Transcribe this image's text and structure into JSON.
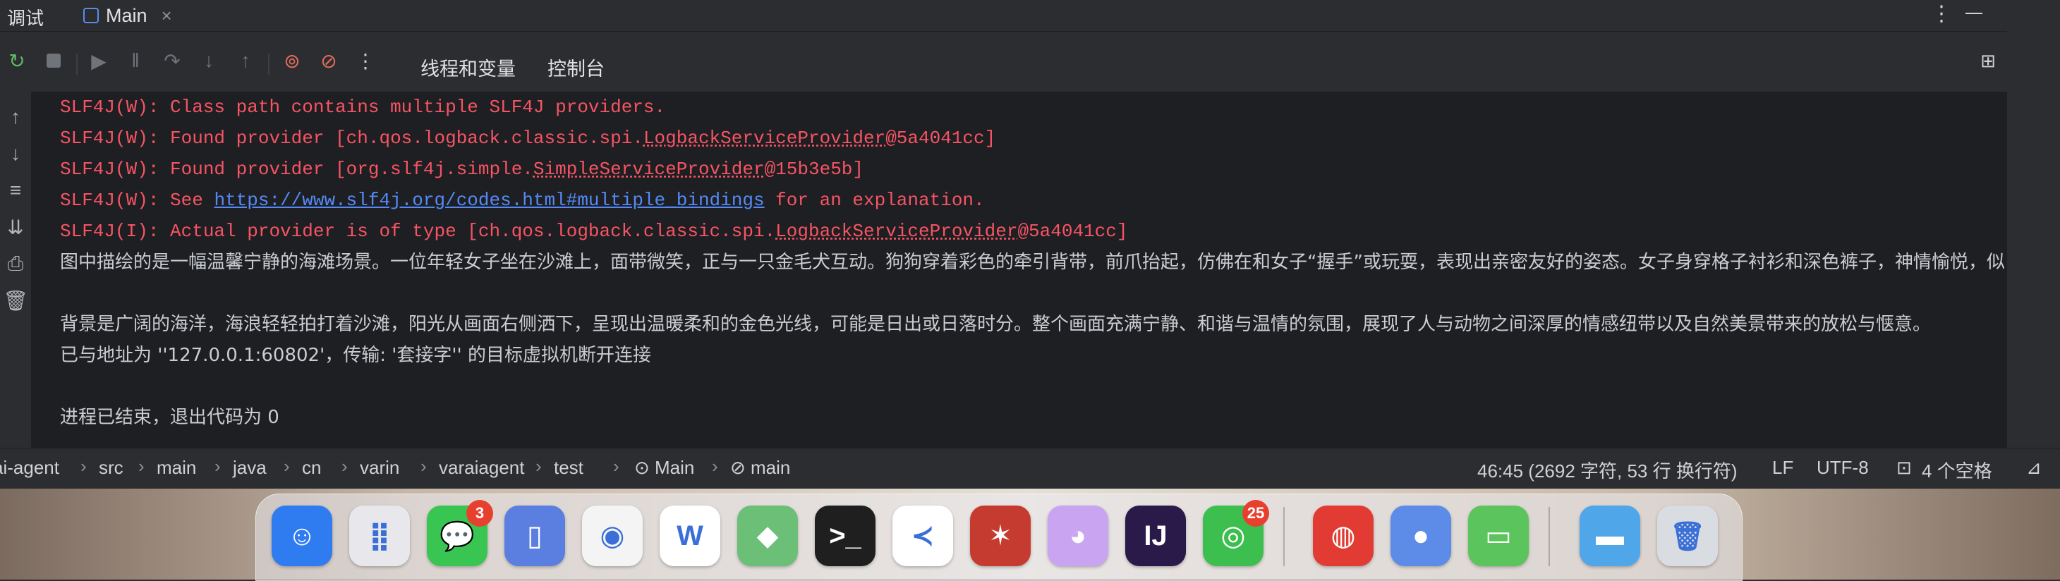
{
  "header": {
    "tool_title": "调试",
    "tab_label": "Main",
    "tab_close": "×",
    "more": "⋮"
  },
  "toolbar": {
    "tabs": [
      "线程和变量",
      "控制台"
    ],
    "active_tab": "控制台"
  },
  "console": {
    "lines": [
      {
        "type": "err",
        "parts": [
          {
            "t": "SLF4J(W): Class path contains multiple SLF4J providers."
          }
        ]
      },
      {
        "type": "err",
        "parts": [
          {
            "t": "SLF4J(W): Found provider [ch.qos.logback.classic.spi."
          },
          {
            "t": "LogbackServiceProvider",
            "dot": true
          },
          {
            "t": "@5a4041cc]"
          }
        ]
      },
      {
        "type": "err",
        "parts": [
          {
            "t": "SLF4J(W): Found provider [org.slf4j.simple."
          },
          {
            "t": "SimpleServiceProvider",
            "dot": true
          },
          {
            "t": "@15b3e5b]"
          }
        ]
      },
      {
        "type": "err",
        "parts": [
          {
            "t": "SLF4J(W): See "
          },
          {
            "t": "https://www.slf4j.org/codes.html#multiple_bindings",
            "link": true
          },
          {
            "t": " for an explanation."
          }
        ]
      },
      {
        "type": "err",
        "parts": [
          {
            "t": "SLF4J(I): Actual provider is of type [ch.qos.logback.classic.spi."
          },
          {
            "t": "LogbackServiceProvider",
            "dot": true
          },
          {
            "t": "@5a4041cc]"
          }
        ]
      },
      {
        "type": "info",
        "parts": [
          {
            "t": "图中描绘的是一幅温馨宁静的海滩场景。一位年轻女子坐在沙滩上，面带微笑，正与一只金毛犬互动。狗狗穿着彩色的牵引背带，前爪抬起，仿佛在和女子“握手”或玩耍，表现出亲密友好的姿态。女子身穿格子衬衫和深色裤子，神情愉悦，似"
          }
        ]
      },
      {
        "type": "blank",
        "parts": []
      },
      {
        "type": "info",
        "parts": [
          {
            "t": "背景是广阔的海洋，海浪轻轻拍打着沙滩，阳光从画面右侧洒下，呈现出温暖柔和的金色光线，可能是日出或日落时分。整个画面充满宁静、和谐与温情的氛围，展现了人与动物之间深厚的情感纽带以及自然美景带来的放松与惬意。"
          }
        ]
      },
      {
        "type": "info",
        "parts": [
          {
            "t": "已与地址为 ''127.0.0.1:60802'，传输: '套接字'' 的目标虚拟机断开连接"
          }
        ]
      },
      {
        "type": "blank",
        "parts": []
      },
      {
        "type": "info",
        "parts": [
          {
            "t": "进程已结束，退出代码为 0"
          }
        ]
      }
    ]
  },
  "breadcrumb": [
    "ai-agent",
    "src",
    "main",
    "java",
    "cn",
    "varin",
    "varaiagent",
    "test",
    "Main",
    "main"
  ],
  "status": {
    "position": "46:45 (2692 字符, 53 行 换行符)",
    "line_sep": "LF",
    "encoding": "UTF-8",
    "indent": "4 个空格"
  },
  "dock": {
    "apps": [
      {
        "name": "finder",
        "glyph": "☺",
        "color": "#2f7bf0"
      },
      {
        "name": "launchpad",
        "glyph": "⣿",
        "color": "#e8e8ec"
      },
      {
        "name": "messages",
        "glyph": "💬",
        "color": "#39c552",
        "badge": "3"
      },
      {
        "name": "iphone-mirroring",
        "glyph": "▯",
        "color": "#5b7fe0"
      },
      {
        "name": "chrome",
        "glyph": "◉",
        "color": "#f4f4f4"
      },
      {
        "name": "wps",
        "glyph": "W",
        "color": "#ffffff"
      },
      {
        "name": "maps",
        "glyph": "◆",
        "color": "#6cbf76"
      },
      {
        "name": "terminal",
        "glyph": ">_",
        "color": "#1f1f1f"
      },
      {
        "name": "vscode",
        "glyph": "≺",
        "color": "#ffffff"
      },
      {
        "name": "knot",
        "glyph": "✶",
        "color": "#c53b2f"
      },
      {
        "name": "cat-app",
        "glyph": "◕",
        "color": "#c9a4f0"
      },
      {
        "name": "intellij",
        "glyph": "IJ",
        "color": "#2a1a4a"
      },
      {
        "name": "wechat",
        "glyph": "◎",
        "color": "#3dbf4f",
        "badge": "25"
      },
      {
        "name": "netease-music",
        "glyph": "◍",
        "color": "#e23b33"
      },
      {
        "name": "preview",
        "glyph": "●",
        "color": "#5c8be8"
      },
      {
        "name": "messages-2",
        "glyph": "▭",
        "color": "#5cc45c"
      },
      {
        "name": "folder",
        "glyph": "▬",
        "color": "#4fa6e8"
      },
      {
        "name": "trash",
        "glyph": "🗑",
        "color": "#d9dde2"
      }
    ]
  }
}
